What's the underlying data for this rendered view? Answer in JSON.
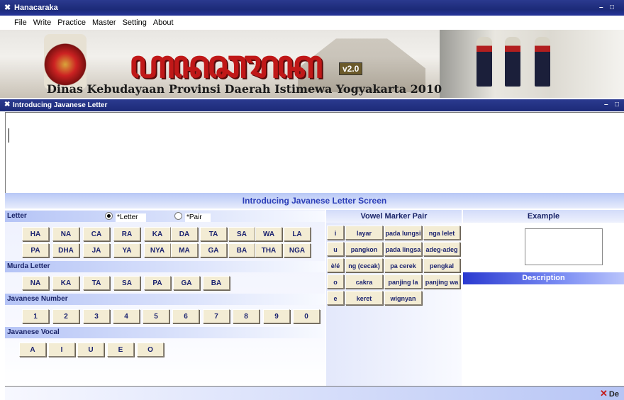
{
  "window": {
    "title": "Hanacaraka",
    "controls": [
      "–",
      "□"
    ]
  },
  "menu": [
    "File",
    "Write",
    "Practice",
    "Master",
    "Setting",
    "About"
  ],
  "banner": {
    "javanese_title": "ꦲꦤꦕꦫꦏ",
    "version": "v2.0",
    "caption": "Dinas Kebudayaan Provinsi Daerah Istimewa Yogyakarta 2010"
  },
  "child_window": {
    "title": "Introducing Javanese Letter",
    "controls": [
      "–",
      "□"
    ]
  },
  "screen_title": "Introducing Javanese Letter Screen",
  "letter_section": {
    "label": "Letter",
    "radio_letter": "*Letter",
    "radio_pair": "*Pair",
    "row1": [
      "HA",
      "NA",
      "CA",
      "RA",
      "KA",
      "DA",
      "TA",
      "SA",
      "WA",
      "LA"
    ],
    "row2": [
      "PA",
      "DHA",
      "JA",
      "YA",
      "NYA",
      "MA",
      "GA",
      "BA",
      "THA",
      "NGA"
    ]
  },
  "murda_section": {
    "label": "Murda Letter",
    "items": [
      "NA",
      "KA",
      "TA",
      "SA",
      "PA",
      "GA",
      "BA"
    ]
  },
  "number_section": {
    "label": "Javanese Number",
    "items": [
      "1",
      "2",
      "3",
      "4",
      "5",
      "6",
      "7",
      "8",
      "9",
      "0"
    ]
  },
  "vocal_section": {
    "label": "Javanese Vocal",
    "items": [
      "A",
      "I",
      "U",
      "E",
      "O"
    ]
  },
  "vowel_marker": {
    "label": "Vowel Marker Pair",
    "rows": [
      {
        "key": "i",
        "items": [
          "layar",
          "pada lungsi",
          "nga lelet"
        ]
      },
      {
        "key": "u",
        "items": [
          "pangkon",
          "pada lingsa",
          "adeg-adeg"
        ]
      },
      {
        "key": "è/é",
        "items": [
          "ng (cecak)",
          "pa cerek",
          "pengkal"
        ]
      },
      {
        "key": "o",
        "items": [
          "cakra",
          "panjing la",
          "panjing wa"
        ]
      },
      {
        "key": "e",
        "items": [
          "keret",
          "wignyan"
        ]
      }
    ]
  },
  "example": {
    "label": "Example"
  },
  "description": {
    "label": "Description"
  },
  "status": {
    "delete_label": "De"
  }
}
